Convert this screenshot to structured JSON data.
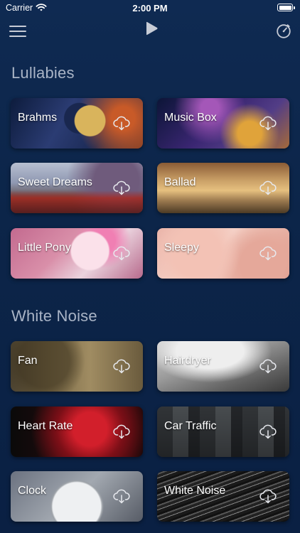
{
  "status_bar": {
    "carrier": "Carrier",
    "time": "2:00 PM"
  },
  "nav": {
    "menu_icon": "hamburger-menu-icon",
    "play_icon": "play-icon",
    "timer_icon": "timer-icon"
  },
  "sections": {
    "lullabies": {
      "title": "Lullabies",
      "items": [
        {
          "label": "Brahms"
        },
        {
          "label": "Music Box"
        },
        {
          "label": "Sweet Dreams"
        },
        {
          "label": "Ballad"
        },
        {
          "label": "Little Pony"
        },
        {
          "label": "Sleepy"
        }
      ]
    },
    "white_noise": {
      "title": "White Noise",
      "items": [
        {
          "label": "Fan"
        },
        {
          "label": "Hairdryer"
        },
        {
          "label": "Heart Rate"
        },
        {
          "label": "Car Traffic"
        },
        {
          "label": "Clock"
        },
        {
          "label": "White Noise"
        }
      ]
    }
  },
  "colors": {
    "background": "#0d2649",
    "section_title": "#a9b4c6",
    "icon": "#c7ccd6"
  }
}
